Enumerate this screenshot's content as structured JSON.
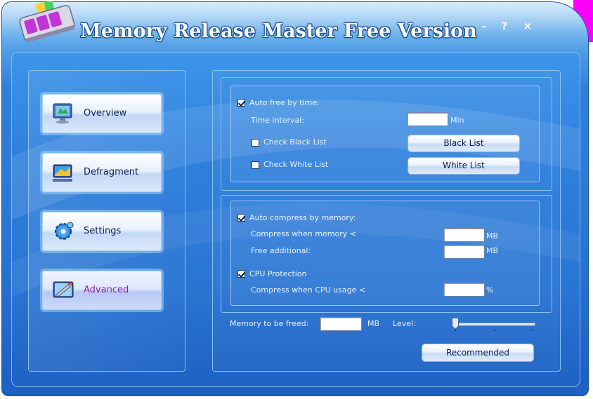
{
  "window": {
    "title": "Memory Release Master Free Version",
    "controls": {
      "minimize": "–",
      "help": "?",
      "close": "×"
    }
  },
  "nav": [
    {
      "label": "Overview",
      "icon": "monitor-icon",
      "active": false
    },
    {
      "label": "Defragment",
      "icon": "defragment-icon",
      "active": false
    },
    {
      "label": "Settings",
      "icon": "gear-icon",
      "active": false
    },
    {
      "label": "Advanced",
      "icon": "advanced-tools-icon",
      "active": true
    }
  ],
  "time_group": {
    "auto_free_label": "Auto free by time:",
    "auto_free_checked": true,
    "time_interval_label": "Time interval:",
    "time_interval_value": "",
    "time_interval_unit": "Min",
    "check_black_list_label": "Check Black List",
    "check_black_list_checked": false,
    "check_white_list_label": "Check White List",
    "check_white_list_checked": false,
    "black_list_button": "Black List",
    "white_list_button": "White List"
  },
  "memory_group": {
    "auto_compress_label": "Auto compress by memory:",
    "auto_compress_checked": true,
    "compress_when_label": "Compress when memory <",
    "compress_when_value": "",
    "compress_when_unit": "MB",
    "free_additional_label": "Free additional:",
    "free_additional_value": "",
    "free_additional_unit": "MB",
    "cpu_protection_label": "CPU Protection",
    "cpu_protection_checked": true,
    "cpu_usage_label": "Compress when CPU usage <",
    "cpu_usage_value": "",
    "cpu_usage_unit": "%"
  },
  "bottom": {
    "memory_to_free_label": "Memory to be freed:",
    "memory_to_free_value": "",
    "memory_to_free_unit": "MB",
    "level_label": "Level:",
    "level_value": 0,
    "recommended_button": "Recommended"
  },
  "colors": {
    "frame_blue": "#2f7fd8",
    "button_text": "#0a1e56",
    "active_nav_text": "#8b1fa6",
    "corner_magenta": "#ff00ff"
  }
}
